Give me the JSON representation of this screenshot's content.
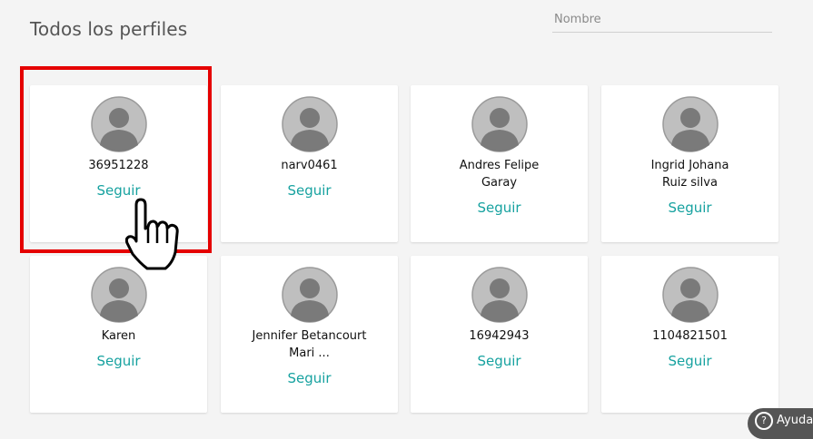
{
  "page": {
    "title": "Todos los perfiles"
  },
  "search": {
    "placeholder": "Nombre"
  },
  "profiles": [
    {
      "name": "36951228",
      "action": "Seguir"
    },
    {
      "name": "narv0461",
      "action": "Seguir"
    },
    {
      "name": "Andres Felipe Garay",
      "action": "Seguir"
    },
    {
      "name": "Ingrid Johana Ruiz silva",
      "action": "Seguir"
    },
    {
      "name": "Karen",
      "action": "Seguir"
    },
    {
      "name": "Jennifer Betancourt Mari ...",
      "action": "Seguir"
    },
    {
      "name": "16942943",
      "action": "Seguir"
    },
    {
      "name": "1104821501",
      "action": "Seguir"
    }
  ],
  "help": {
    "label": "Ayuda"
  },
  "icons": {
    "avatar": "user-avatar-icon",
    "cursor": "hand-pointer-icon",
    "help": "question-icon"
  },
  "colors": {
    "accent": "#17a2a0",
    "highlight": "#e50000"
  }
}
